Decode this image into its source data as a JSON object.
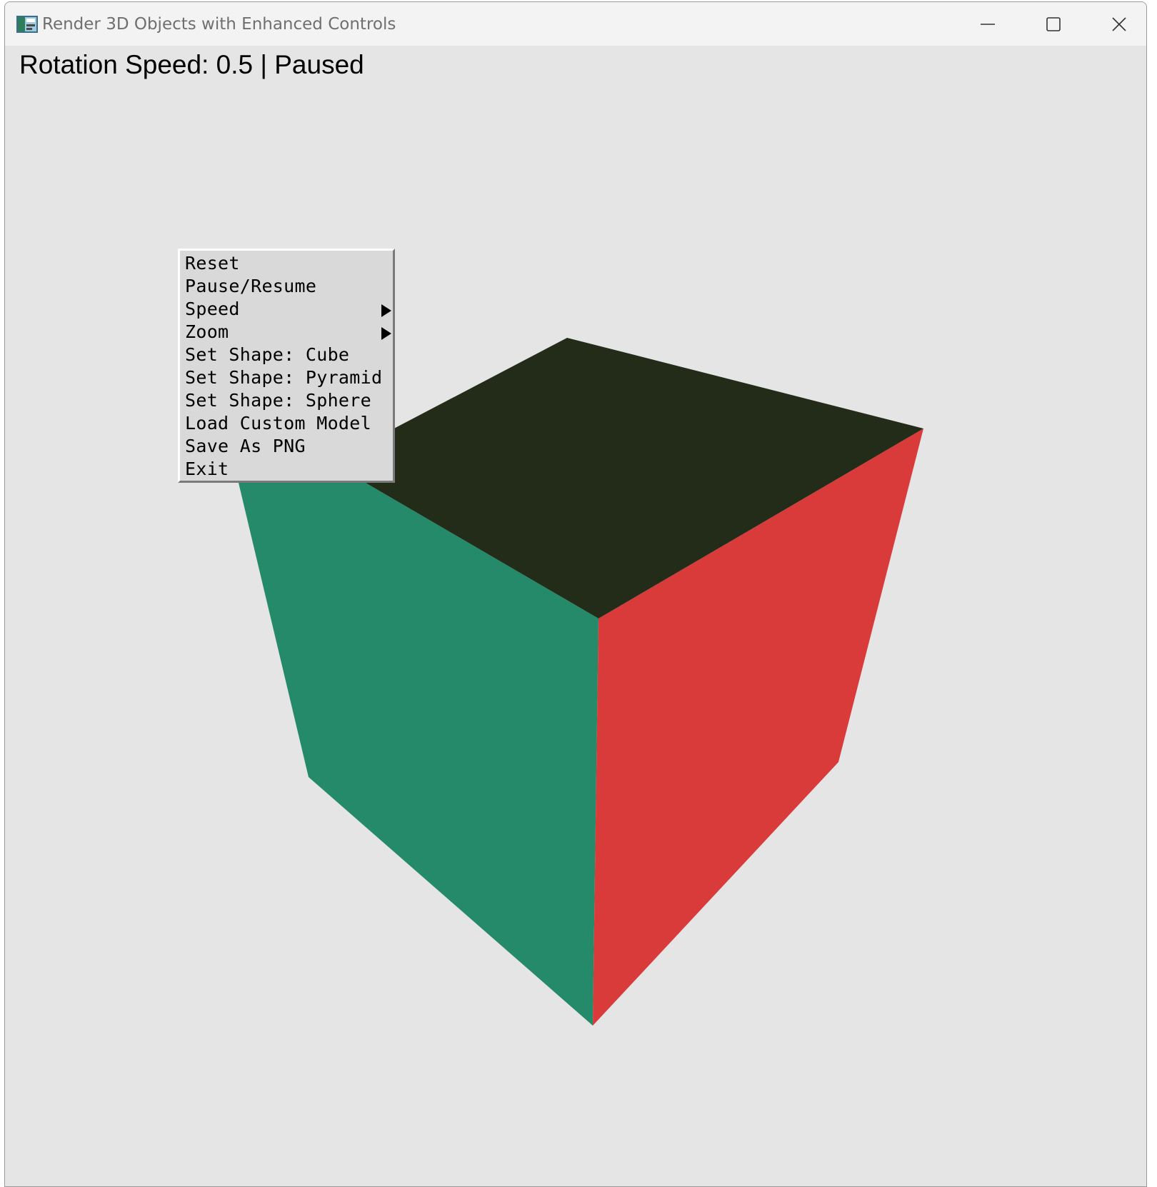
{
  "window": {
    "title": "Render 3D Objects with Enhanced Controls",
    "controls": {
      "minimize": "minimize-icon",
      "maximize": "maximize-icon",
      "close": "close-icon"
    }
  },
  "status": {
    "text": "Rotation Speed: 0.5 | Paused"
  },
  "scene": {
    "shape": "cube",
    "face_colors": {
      "top": "#232c18",
      "left": "#258a69",
      "right": "#d93b3a"
    },
    "background": "#e5e5e5"
  },
  "context_menu": {
    "items": [
      {
        "label": "Reset",
        "submenu": false
      },
      {
        "label": "Pause/Resume",
        "submenu": false
      },
      {
        "label": "Speed",
        "submenu": true
      },
      {
        "label": "Zoom",
        "submenu": true
      },
      {
        "label": "Set Shape: Cube",
        "submenu": false
      },
      {
        "label": "Set Shape: Pyramid",
        "submenu": false
      },
      {
        "label": "Set Shape: Sphere",
        "submenu": false
      },
      {
        "label": "Load Custom Model",
        "submenu": false
      },
      {
        "label": "Save As PNG",
        "submenu": false
      },
      {
        "label": "Exit",
        "submenu": false
      }
    ]
  }
}
